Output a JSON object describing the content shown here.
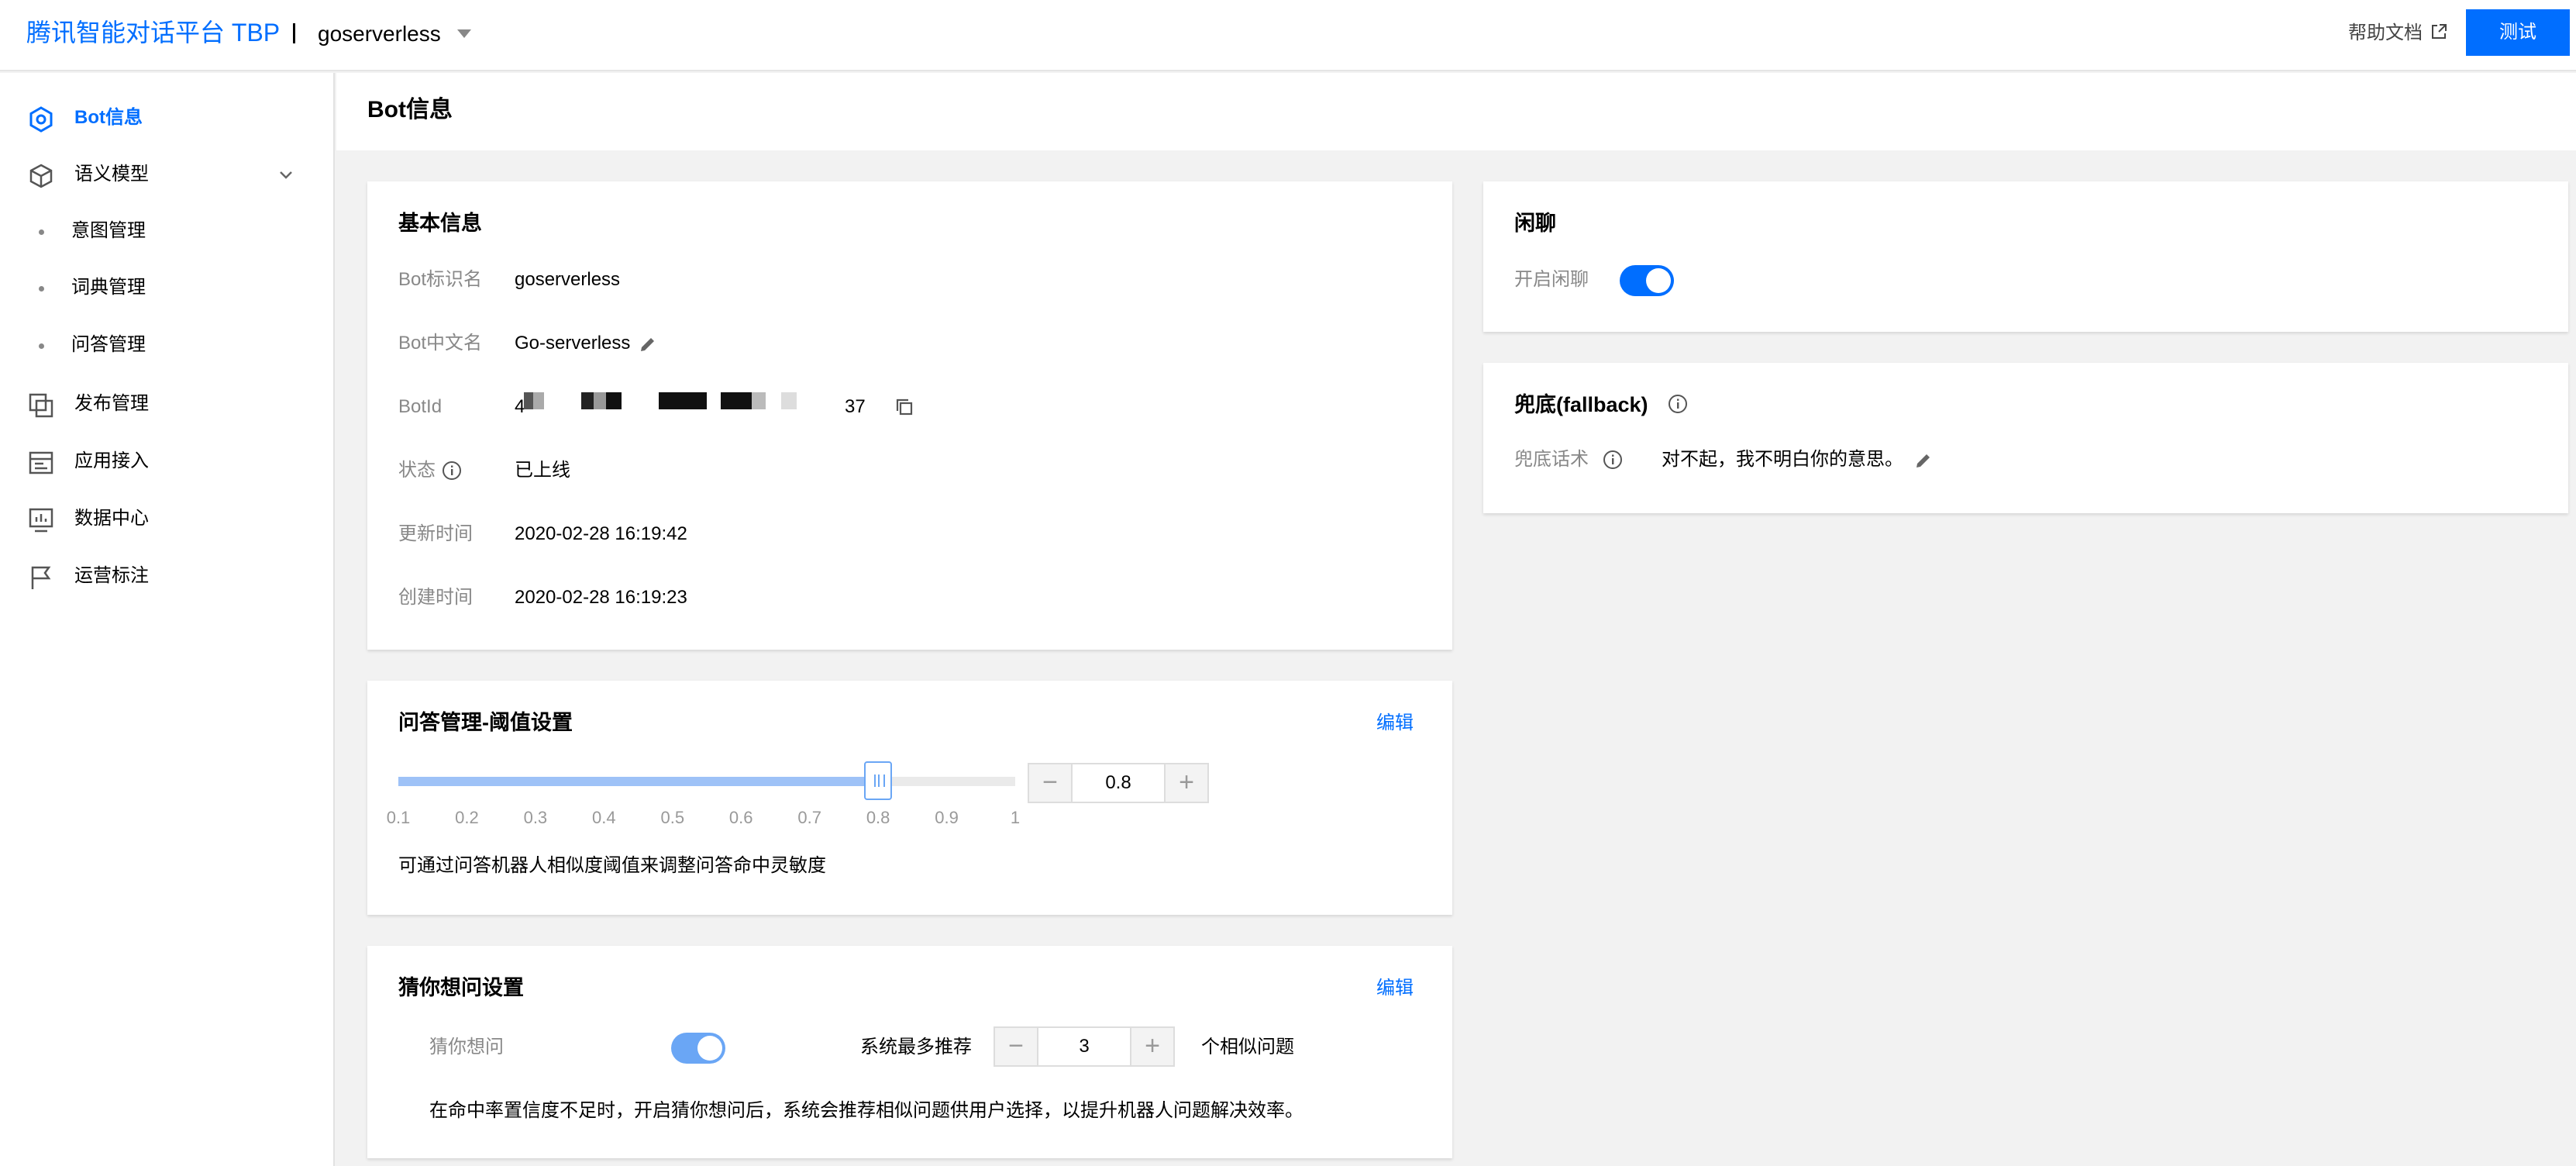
{
  "header": {
    "brand": "腾讯智能对话平台 TBP",
    "project": "goserverless",
    "help_label": "帮助文档",
    "test_label": "测试"
  },
  "sidebar": {
    "items": [
      {
        "label": "Bot信息",
        "icon": "bot-icon",
        "active": true
      },
      {
        "label": "语义模型",
        "icon": "cube-icon",
        "expandable": true
      },
      {
        "label": "意图管理",
        "sub": true
      },
      {
        "label": "词典管理",
        "sub": true
      },
      {
        "label": "问答管理",
        "sub": true
      },
      {
        "label": "发布管理",
        "icon": "publish-icon"
      },
      {
        "label": "应用接入",
        "icon": "app-access-icon"
      },
      {
        "label": "数据中心",
        "icon": "data-center-icon"
      },
      {
        "label": "运营标注",
        "icon": "flag-icon"
      }
    ]
  },
  "page": {
    "title": "Bot信息"
  },
  "basic_info": {
    "title": "基本信息",
    "rows": [
      {
        "label": "Bot标识名",
        "value": "goserverless"
      },
      {
        "label": "Bot中文名",
        "value": "Go-serverless"
      },
      {
        "label": "BotId",
        "value_start": "4",
        "value_end": "37"
      },
      {
        "label": "状态",
        "value": "已上线"
      },
      {
        "label": "更新时间",
        "value": "2020-02-28 16:19:42"
      },
      {
        "label": "创建时间",
        "value": "2020-02-28 16:19:23"
      }
    ]
  },
  "qa_threshold": {
    "title": "问答管理-阈值设置",
    "edit_label": "编辑",
    "value": "0.8",
    "min": 0.1,
    "max": 1,
    "ticks": [
      "0.1",
      "0.2",
      "0.3",
      "0.4",
      "0.5",
      "0.6",
      "0.7",
      "0.8",
      "0.9",
      "1"
    ],
    "minus": "−",
    "plus": "+",
    "description": "可通过问答机器人相似度阈值来调整问答命中灵敏度"
  },
  "guess": {
    "title": "猜你想问设置",
    "edit_label": "编辑",
    "toggle_label": "猜你想问",
    "enabled": true,
    "max_label": "系统最多推荐",
    "max_value": "3",
    "unit_label": "个相似问题",
    "minus": "−",
    "plus": "+",
    "description": "在命中率置信度不足时，开启猜你想问后，系统会推荐相似问题供用户选择，以提升机器人问题解决效率。"
  },
  "chitchat": {
    "title": "闲聊",
    "toggle_label": "开启闲聊",
    "enabled": true
  },
  "fallback": {
    "title": "兜底(fallback)",
    "label": "兜底话术",
    "value": "对不起，我不明白你的意思。"
  },
  "colors": {
    "accent": "#006eff",
    "toggle_soft": "#6aa6f5",
    "muted_text": "#888888",
    "page_bg": "#f2f2f2"
  }
}
